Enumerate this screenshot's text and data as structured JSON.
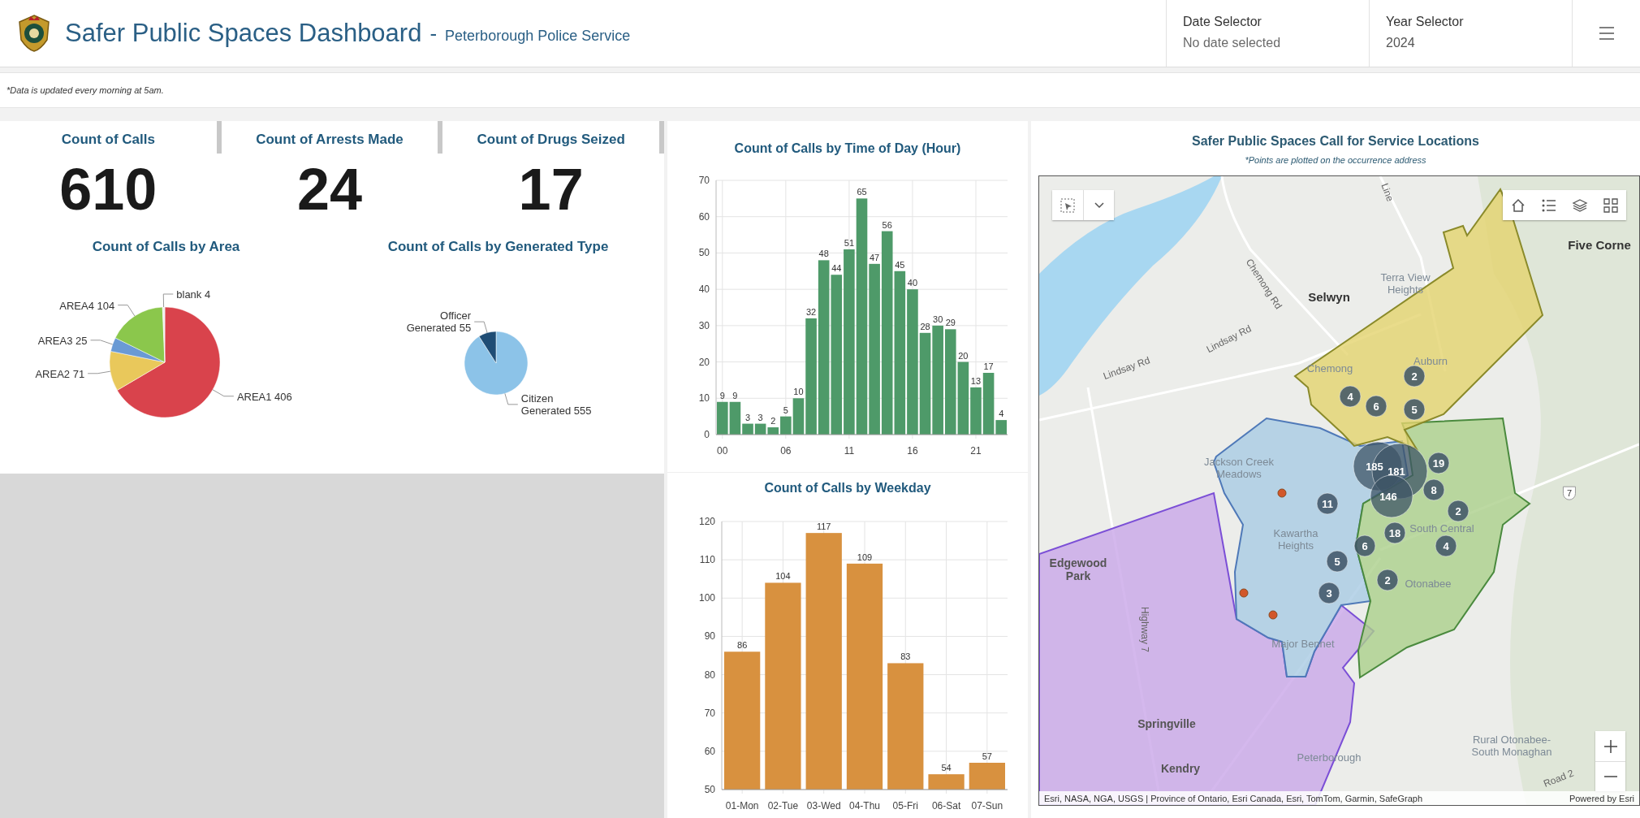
{
  "header": {
    "title": "Safer Public Spaces Dashboard",
    "separator": "-",
    "subtitle": "Peterborough Police Service",
    "selectors": [
      {
        "label": "Date Selector",
        "placeholder": "No date selected"
      },
      {
        "label": "Year Selector",
        "value": "2024"
      }
    ]
  },
  "notice": "*Data is updated every morning at 5am.",
  "indicators": [
    {
      "title": "Count of Calls",
      "value": "610"
    },
    {
      "title": "Count of Arrests Made",
      "value": "24"
    },
    {
      "title": "Count of Drugs Seized",
      "value": "17"
    }
  ],
  "pie_charts": [
    {
      "chart_data": {
        "type": "pie",
        "title": "Count of Calls by Area",
        "categories": [
          "AREA1 406",
          "AREA2 71",
          "AREA3 25",
          "AREA4 104",
          "blank 4"
        ],
        "values": [
          406,
          71,
          25,
          104,
          4
        ]
      }
    },
    {
      "chart_data": {
        "type": "pie",
        "title": "Count of Calls by Generated Type",
        "categories": [
          "Citizen Generated 555",
          "Officer Generated 55"
        ],
        "values": [
          555,
          55
        ]
      }
    }
  ],
  "hour_chart": {
    "chart_data": {
      "type": "bar",
      "title": "Count of Calls by Time of Day (Hour)",
      "categories": [
        "00",
        null,
        null,
        null,
        null,
        "06",
        null,
        null,
        null,
        null,
        "11",
        null,
        null,
        null,
        null,
        "16",
        null,
        null,
        null,
        null,
        "21",
        null,
        null
      ],
      "series": [
        {
          "color": "#4e9a69",
          "values": [
            9,
            9,
            3,
            3,
            2,
            5,
            10,
            32,
            48,
            44,
            51,
            65,
            47,
            56,
            45,
            40,
            28,
            30,
            29,
            20,
            13,
            17,
            4
          ]
        }
      ],
      "ylim": [
        0,
        70
      ],
      "yticks": [
        0,
        10,
        20,
        30,
        40,
        50,
        60,
        70
      ],
      "grid": true,
      "data_labels": true
    }
  },
  "weekday_chart": {
    "chart_data": {
      "type": "bar",
      "title": "Count of Calls by Weekday",
      "categories": [
        "01-Mon",
        "02-Tue",
        "03-Wed",
        "04-Thu",
        "05-Fri",
        "06-Sat",
        "07-Sun"
      ],
      "series": [
        {
          "color": "#d8913f",
          "values": [
            86,
            104,
            117,
            109,
            83,
            54,
            57
          ]
        }
      ],
      "ylim": [
        50,
        120
      ],
      "yticks": [
        50,
        60,
        70,
        80,
        90,
        100,
        110,
        120
      ],
      "grid": true,
      "data_labels": true
    }
  },
  "map": {
    "title": "Safer Public Spaces Call for Service Locations",
    "subtitle": "*Points are plotted on the occurrence address",
    "labels": [
      {
        "text": "Five Corne",
        "kind": "town"
      },
      {
        "text": "Selwyn",
        "kind": "town"
      },
      {
        "text": "Terra View Heights",
        "kind": "neighbourhood"
      },
      {
        "text": "Chemong Rd",
        "kind": "road"
      },
      {
        "text": "Lindsay Rd",
        "kind": "road"
      },
      {
        "text": "Lindsay Rd",
        "kind": "road"
      },
      {
        "text": "Line",
        "kind": "road"
      },
      {
        "text": "Chemong",
        "kind": "neighbourhood"
      },
      {
        "text": "Auburn",
        "kind": "neighbourhood"
      },
      {
        "text": "Jackson Creek Meadows",
        "kind": "neighbourhood"
      },
      {
        "text": "South Central",
        "kind": "neighbourhood"
      },
      {
        "text": "Kawartha Heights",
        "kind": "neighbourhood"
      },
      {
        "text": "Otonabee",
        "kind": "neighbourhood"
      },
      {
        "text": "Major Bennet",
        "kind": "neighbourhood"
      },
      {
        "text": "Edgewood Park",
        "kind": "place"
      },
      {
        "text": "Highway 7",
        "kind": "road"
      },
      {
        "text": "Springville",
        "kind": "place"
      },
      {
        "text": "Peterborough",
        "kind": "neighbourhood"
      },
      {
        "text": "Kendry",
        "kind": "place"
      },
      {
        "text": "Rural Otonabee-South Monaghan",
        "kind": "neighbourhood"
      },
      {
        "text": "Road 2",
        "kind": "road"
      },
      {
        "text": "7",
        "kind": "shield"
      }
    ],
    "clusters": [
      "2",
      "4",
      "6",
      "5",
      "185",
      "181",
      "146",
      "19",
      "8",
      "2",
      "11",
      "18",
      "6",
      "4",
      "5",
      "2",
      "3"
    ],
    "attribution": "Esri, NASA, NGA, USGS | Province of Ontario, Esri Canada, Esri, TomTom, Garmin, SafeGraph",
    "powered_by": "Powered by Esri"
  }
}
